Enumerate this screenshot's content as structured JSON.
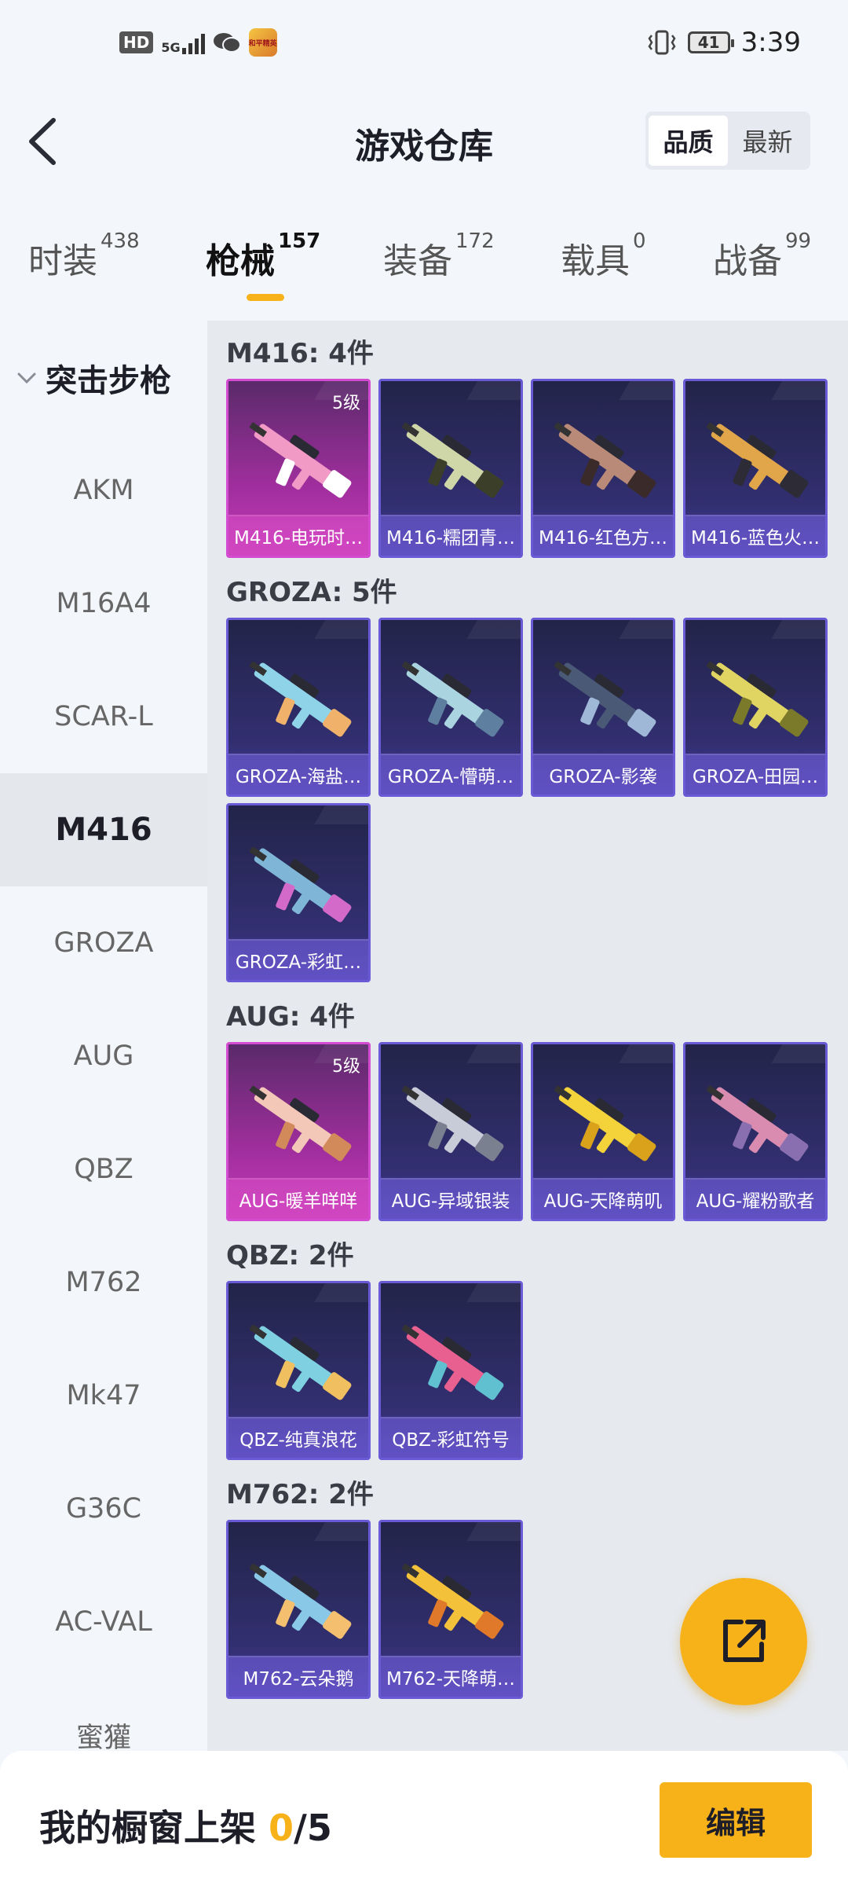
{
  "status_bar": {
    "hd_badge": "HD",
    "network": "5G",
    "app_icon_text": "和平精英",
    "battery": "41",
    "time": "3:39"
  },
  "header": {
    "title": "游戏仓库",
    "sort_options": [
      "品质",
      "最新"
    ],
    "active_sort": "品质"
  },
  "tabs": [
    {
      "label": "时装",
      "count": "438"
    },
    {
      "label": "枪械",
      "count": "157"
    },
    {
      "label": "装备",
      "count": "172"
    },
    {
      "label": "载具",
      "count": "0"
    },
    {
      "label": "战备",
      "count": "99"
    }
  ],
  "active_tab": "枪械",
  "sidebar": {
    "group": "突击步枪",
    "items": [
      "AKM",
      "M16A4",
      "SCAR-L",
      "M416",
      "GROZA",
      "AUG",
      "QBZ",
      "M762",
      "Mk47",
      "G36C",
      "AC-VAL",
      "蜜獾"
    ],
    "active": "M416"
  },
  "sections": [
    {
      "title": "M416: 4件",
      "items": [
        {
          "name": "M416-电玩时…",
          "level": "5级",
          "tier": "legendary"
        },
        {
          "name": "M416-糯团青…"
        },
        {
          "name": "M416-红色方…"
        },
        {
          "name": "M416-蓝色火…"
        }
      ]
    },
    {
      "title": "GROZA: 5件",
      "items": [
        {
          "name": "GROZA-海盐…"
        },
        {
          "name": "GROZA-懵萌…"
        },
        {
          "name": "GROZA-影袭"
        },
        {
          "name": "GROZA-田园…"
        },
        {
          "name": "GROZA-彩虹…"
        }
      ]
    },
    {
      "title": "AUG: 4件",
      "items": [
        {
          "name": "AUG-暖羊咩咩",
          "level": "5级",
          "tier": "legendary"
        },
        {
          "name": "AUG-异域银装"
        },
        {
          "name": "AUG-天降萌叽"
        },
        {
          "name": "AUG-耀粉歌者"
        }
      ]
    },
    {
      "title": "QBZ: 2件",
      "items": [
        {
          "name": "QBZ-纯真浪花"
        },
        {
          "name": "QBZ-彩虹符号"
        }
      ]
    },
    {
      "title": "M762: 2件",
      "items": [
        {
          "name": "M762-云朵鹅"
        },
        {
          "name": "M762-天降萌…"
        }
      ]
    }
  ],
  "bottom_bar": {
    "label": "我的橱窗上架",
    "current": "0",
    "separator": "/",
    "total": "5",
    "edit_button": "编辑"
  },
  "colors": {
    "accent": "#f7b21a",
    "card_bg": "#2c2b63",
    "legendary_bg": "#b1309f"
  },
  "icons": {
    "back": "chevron-left-icon",
    "share": "share-export-icon",
    "sidebar_group": "chevron-down-icon"
  }
}
